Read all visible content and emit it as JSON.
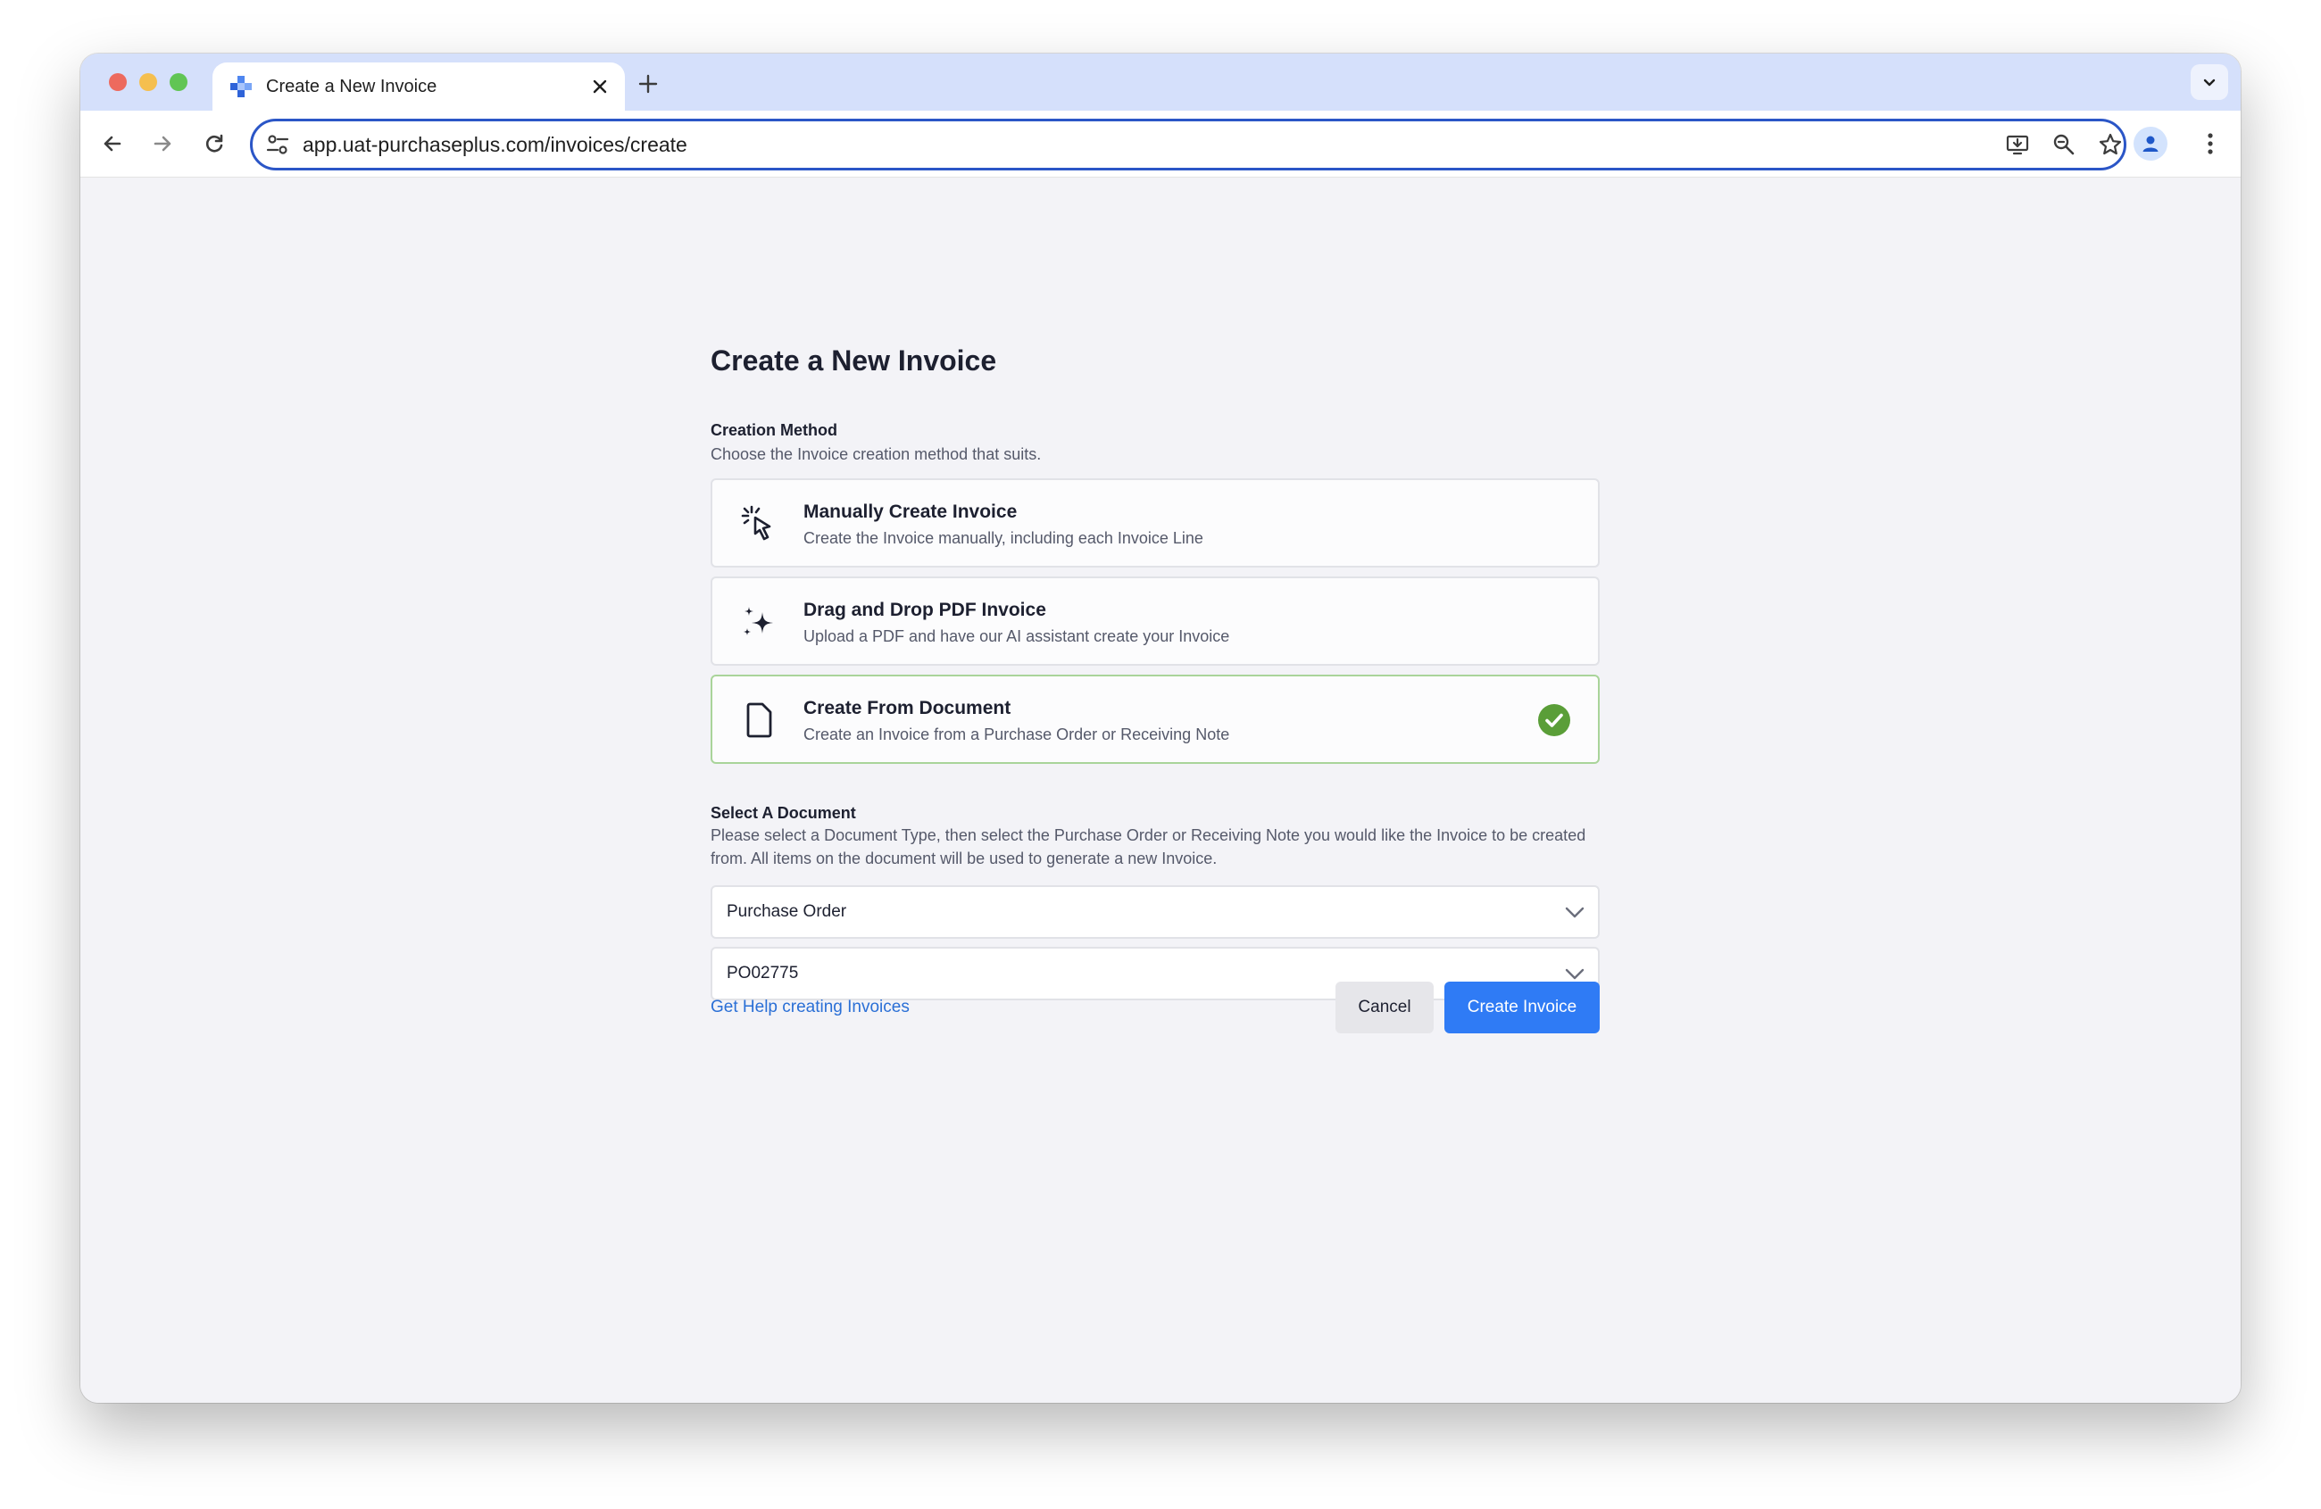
{
  "browser": {
    "tab": {
      "title": "Create a New Invoice",
      "favicon": "purchaseplus-logo-icon"
    },
    "address_bar": {
      "url": "app.uat-purchaseplus.com/invoices/create"
    },
    "icons": {
      "back": "arrow-left-icon",
      "forward": "arrow-right-icon",
      "reload": "reload-icon",
      "site_settings": "tune-icon",
      "install": "install-app-icon",
      "zoom": "zoom-icon",
      "bookmark": "star-icon",
      "profile": "person-icon",
      "menu": "kebab-menu-icon"
    }
  },
  "page": {
    "title": "Create a New Invoice",
    "creation_method": {
      "label": "Creation Method",
      "description": "Choose the Invoice creation method that suits.",
      "options": [
        {
          "title": "Manually Create Invoice",
          "description": "Create the Invoice manually, including each Invoice Line",
          "icon": "cursor-click-icon",
          "selected": false
        },
        {
          "title": "Drag and Drop PDF Invoice",
          "description": "Upload a PDF and have our AI assistant create your Invoice",
          "icon": "sparkles-icon",
          "selected": false
        },
        {
          "title": "Create From Document",
          "description": "Create an Invoice from a Purchase Order or Receiving Note",
          "icon": "document-icon",
          "selected": true
        }
      ]
    },
    "select_document": {
      "label": "Select A Document",
      "description": "Please select a Document Type, then select the Purchase Order or Receiving Note you would like the Invoice to be created from. All items on the document will be used to generate a new Invoice.",
      "document_type": "Purchase Order",
      "document_number": "PO02775"
    },
    "help_link": "Get Help creating Invoices",
    "cancel_label": "Cancel",
    "create_label": "Create Invoice"
  },
  "colors": {
    "primary": "#2f7bf5",
    "selected_border": "#a9d49a",
    "check": "#5a9e38",
    "link": "#2a6fd6",
    "tabstrip": "#d5e0fb"
  }
}
